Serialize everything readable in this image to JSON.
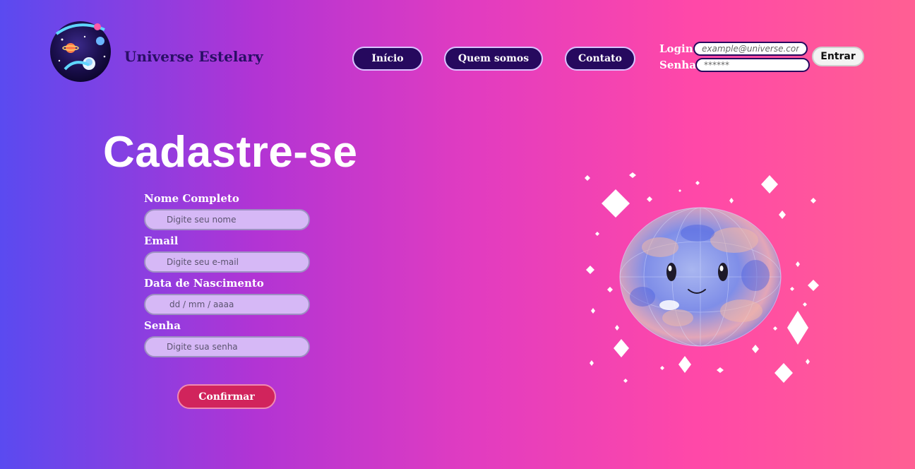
{
  "brand": {
    "name": "Universe Estelary",
    "logo_icon": "astronaut-planet-logo"
  },
  "nav": [
    {
      "label": "Início"
    },
    {
      "label": "Quem somos"
    },
    {
      "label": "Contato"
    }
  ],
  "login": {
    "login_label": "Login",
    "password_label": "Senha",
    "email_placeholder": "example@universe.com",
    "password_placeholder": "******",
    "submit_label": "Entrar"
  },
  "signup": {
    "title": "Cadastre-se",
    "fields": [
      {
        "label": "Nome Completo",
        "placeholder": "Digite seu nome"
      },
      {
        "label": "Email",
        "placeholder": "Digite seu e-mail"
      },
      {
        "label": "Data de Nascimento",
        "placeholder": "dd / mm / aaaa"
      },
      {
        "label": "Senha",
        "placeholder": "Digite sua senha"
      }
    ],
    "confirm_label": "Confirmar"
  },
  "illustration": {
    "icon": "smiling-planet-with-sparkles"
  },
  "colors": {
    "nav_button": "#26095e",
    "confirm_button": "#d1245c",
    "input_fill": "#d6b8f6",
    "gradient_start": "#5a4af0",
    "gradient_end": "#ff5f93"
  }
}
